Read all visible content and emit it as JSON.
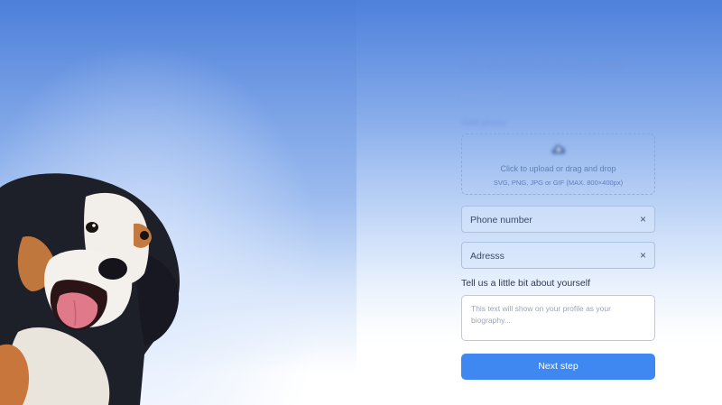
{
  "form": {
    "title": "Tell us more about yourself",
    "subtitle": "Step 2 of 3",
    "photo_label": "Add photo",
    "upload": {
      "line1": "Click to upload or drag and drop",
      "line2": "SVG, PNG, JPG or GIF (MAX. 800×400px)",
      "icon": "upload-cloud-icon"
    },
    "phone": {
      "label": "Phone number",
      "clear": "×"
    },
    "address": {
      "label": "Adresss",
      "clear": "×"
    },
    "bio": {
      "label": "Tell us a little bit about yourself",
      "placeholder": "This text will show on your profile as your biography..."
    },
    "next_label": "Next step"
  },
  "colors": {
    "accent": "#3f88f2",
    "gradient_top": "#4d7fd9"
  }
}
